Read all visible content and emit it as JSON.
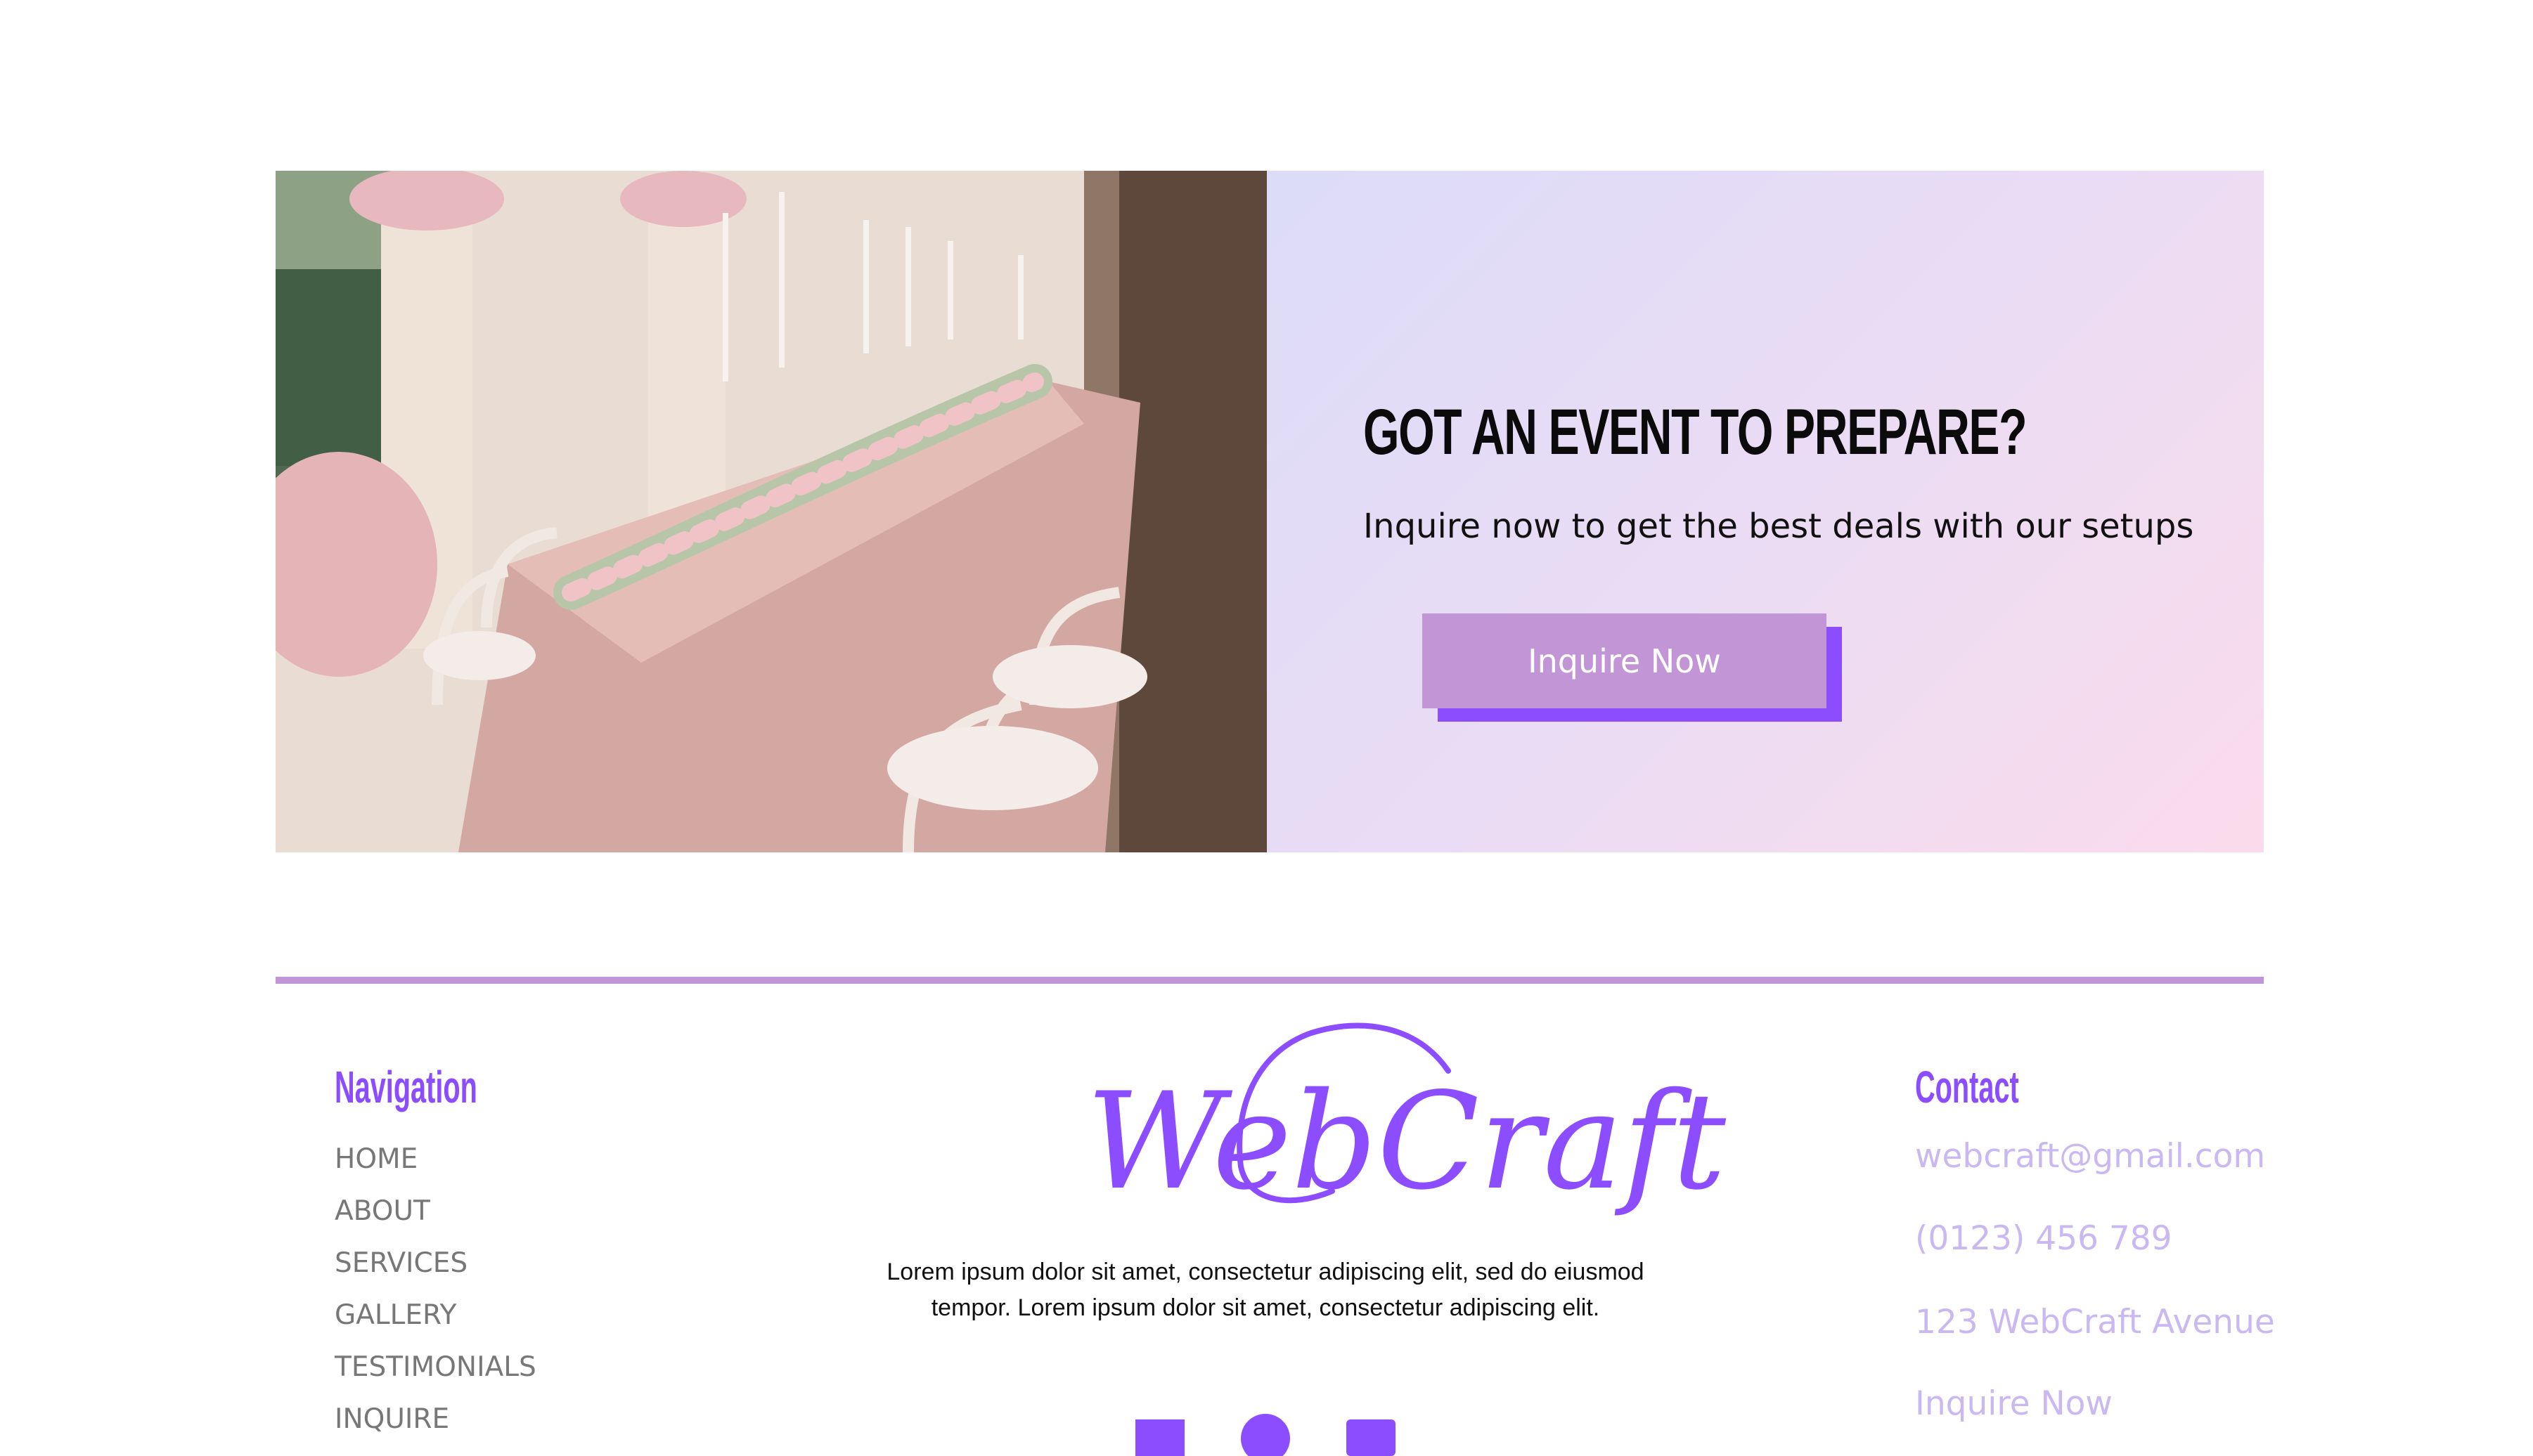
{
  "cta": {
    "image_alt": "Elegant pink wedding reception table with floral garland, candles and white chairs",
    "title": "GOT AN EVENT TO PREPARE?",
    "subtitle": "Inquire now to get the best deals with our setups",
    "button_label": "Inquire Now"
  },
  "footer": {
    "navigation": {
      "heading": "Navigation",
      "items": [
        "HOME",
        "ABOUT",
        "SERVICES",
        "GALLERY",
        "TESTIMONIALS",
        "INQUIRE"
      ]
    },
    "brand": {
      "logo_text": "WebCraft",
      "description": "Lorem ipsum dolor sit amet, consectetur adipiscing elit, sed do eiusmod tempor. Lorem ipsum dolor sit amet, consectetur adipiscing elit."
    },
    "social_icons": [
      "facebook-icon",
      "pinterest-icon",
      "instagram-icon"
    ],
    "contact": {
      "heading": "Contact",
      "email": "webcraft@gmail.com",
      "phone": "(0123) 456 789",
      "address": "123 WebCraft Avenue",
      "inquire_link": "Inquire Now"
    }
  },
  "colors": {
    "accent_purple": "#8b4dff",
    "button_lilac": "#c195d6",
    "contact_text": "#c9b8f2",
    "nav_text": "#777777"
  }
}
